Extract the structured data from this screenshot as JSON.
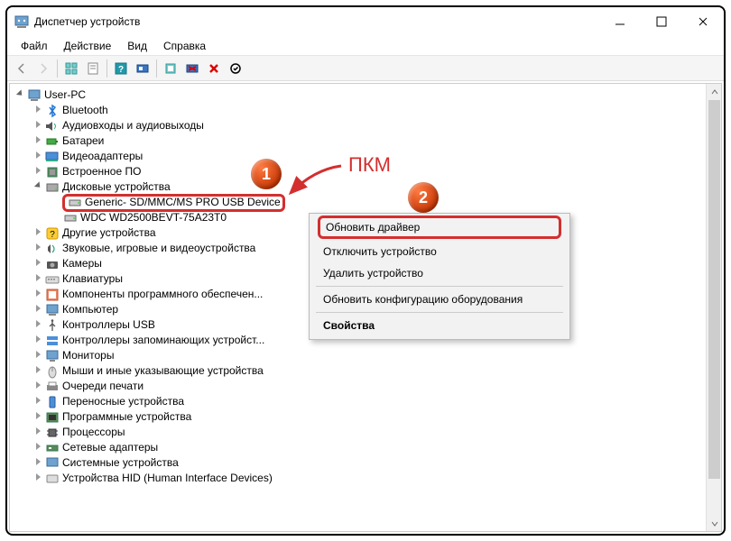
{
  "window": {
    "title": "Диспетчер устройств"
  },
  "menu": {
    "file": "Файл",
    "action": "Действие",
    "view": "Вид",
    "help": "Справка"
  },
  "tree": {
    "root": "User-PC",
    "bluetooth": "Bluetooth",
    "audio": "Аудиовходы и аудиовыходы",
    "batteries": "Батареи",
    "display": "Видеоадаптеры",
    "firmware": "Встроенное ПО",
    "disk": "Дисковые устройства",
    "disk_child1": "Generic- SD/MMC/MS PRO USB Device",
    "disk_child2": "WDC WD2500BEVT-75A23T0",
    "other": "Другие устройства",
    "sound": "Звуковые, игровые и видеоустройства",
    "cameras": "Камеры",
    "keyboards": "Клавиатуры",
    "software_components": "Компоненты программного обеспечен...",
    "computer": "Компьютер",
    "usb_controllers": "Контроллеры USB",
    "storage_controllers": "Контроллеры запоминающих устройст...",
    "monitors": "Мониторы",
    "mice": "Мыши и иные указывающие устройства",
    "print_queues": "Очереди печати",
    "portable": "Переносные устройства",
    "software_devices": "Программные устройства",
    "processors": "Процессоры",
    "network": "Сетевые адаптеры",
    "system": "Системные устройства",
    "hid": "Устройства HID (Human Interface Devices)"
  },
  "context_menu": {
    "update": "Обновить драйвер",
    "disable": "Отключить устройство",
    "uninstall": "Удалить устройство",
    "scan": "Обновить конфигурацию оборудования",
    "properties": "Свойства"
  },
  "annotations": {
    "badge1": "1",
    "badge2": "2",
    "pkm": "ПКМ"
  }
}
